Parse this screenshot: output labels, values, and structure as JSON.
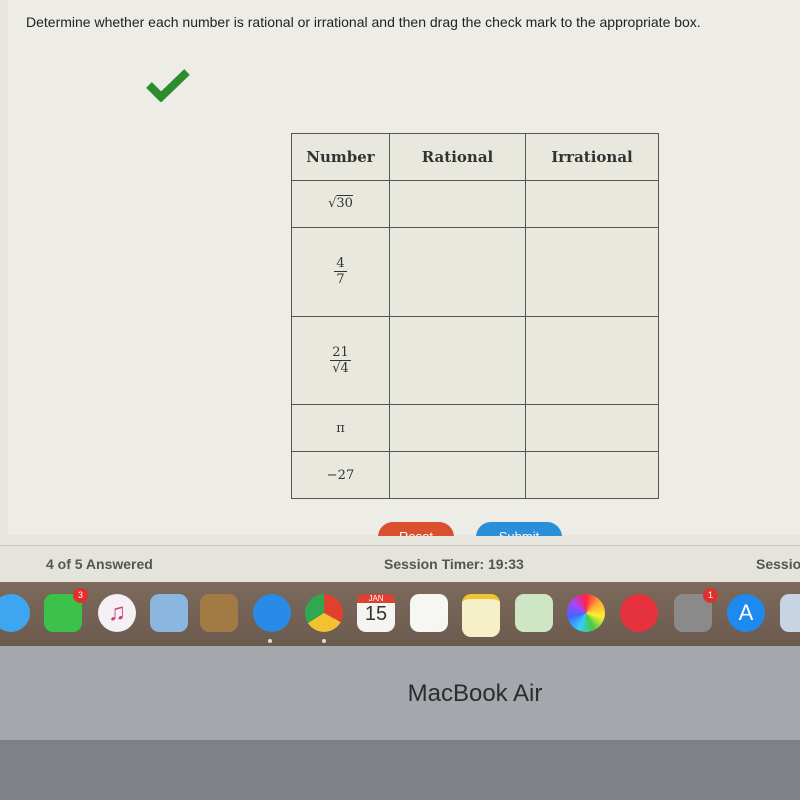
{
  "instruction": "Determine whether each number is rational or irrational and then drag the check mark to the appropriate box.",
  "check_icon_color": "#2e8b2e",
  "table": {
    "headers": [
      "Number",
      "Rational",
      "Irrational"
    ],
    "rows": [
      {
        "type": "sqrt",
        "radicand": "30"
      },
      {
        "type": "frac",
        "num": "4",
        "den": "7"
      },
      {
        "type": "frac-sqrt",
        "num": "21",
        "den": "4"
      },
      {
        "type": "text",
        "value": "π"
      },
      {
        "type": "text",
        "value": "−27"
      }
    ]
  },
  "buttons": {
    "reset": "Reset",
    "submit": "Submit",
    "reset_color": "#d9502e",
    "submit_color": "#2a8fd8"
  },
  "status": {
    "answered": "4 of 5 Answered",
    "timer": "Session Timer: 19:33",
    "right": "Sessio"
  },
  "dock": {
    "facetime_badge": "3",
    "calendar_month": "JAN",
    "calendar_day": "15",
    "settings_badge": "1"
  },
  "device": "MacBook Air"
}
